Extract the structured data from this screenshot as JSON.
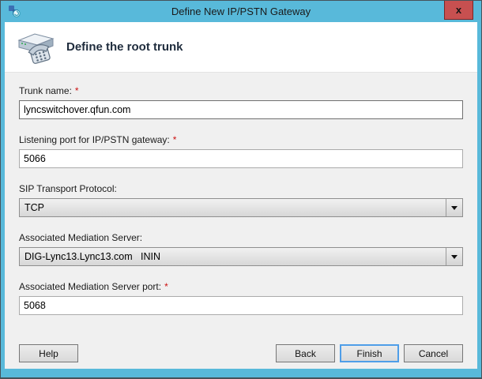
{
  "window": {
    "title": "Define New IP/PSTN Gateway",
    "close_label": "x"
  },
  "header": {
    "title": "Define the root trunk"
  },
  "form": {
    "fields": [
      {
        "label": "Trunk name:",
        "asterisk": "*",
        "value": "lyncswitchover.qfun.com",
        "type": "text"
      },
      {
        "label": "Listening port for IP/PSTN gateway:",
        "asterisk": "*",
        "value": "5066",
        "type": "text"
      },
      {
        "label": "SIP Transport Protocol:",
        "asterisk": "",
        "value": "TCP",
        "type": "select"
      },
      {
        "label": "Associated Mediation Server:",
        "asterisk": "",
        "value": "DIG-Lync13.Lync13.com   ININ",
        "type": "select"
      },
      {
        "label": "Associated Mediation Server port:",
        "asterisk": "*",
        "value": "5068",
        "type": "text"
      }
    ]
  },
  "buttons": {
    "help": "Help",
    "back": "Back",
    "finish": "Finish",
    "cancel": "Cancel"
  },
  "colors": {
    "titlebar": "#58b9da",
    "close_bg": "#c75050",
    "default_button_border": "#4f9ee8",
    "required_asterisk": "#cc1111",
    "body_bg": "#f0f0f0"
  }
}
